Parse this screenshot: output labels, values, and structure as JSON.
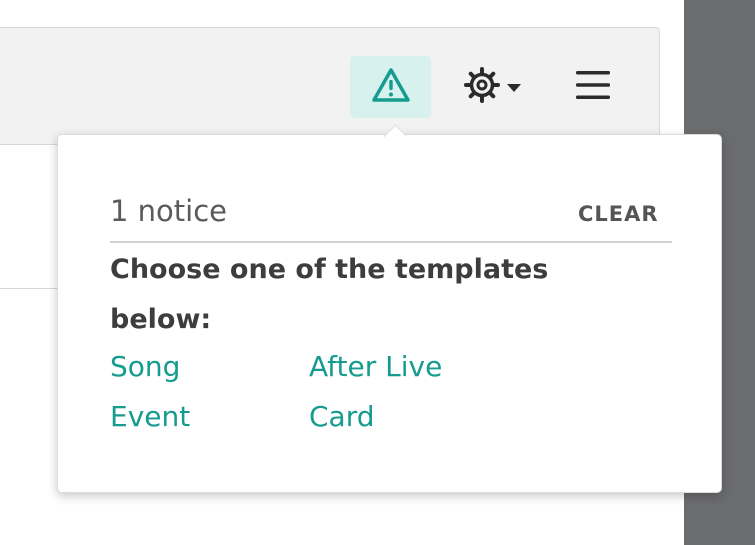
{
  "toolbar": {
    "notice_icon": "warning-triangle-icon",
    "settings_icon": "gear-icon",
    "settings_caret_icon": "caret-down-icon",
    "menu_icon": "hamburger-menu-icon",
    "accent_color": "#169c8e",
    "notice_highlight_color": "#d7f1ef"
  },
  "notices": {
    "count_label": "1 notice",
    "clear_label": "CLEAR",
    "message": "Choose one of the templates below:",
    "templates": [
      "Song",
      "After Live",
      "Event",
      "Card"
    ]
  }
}
